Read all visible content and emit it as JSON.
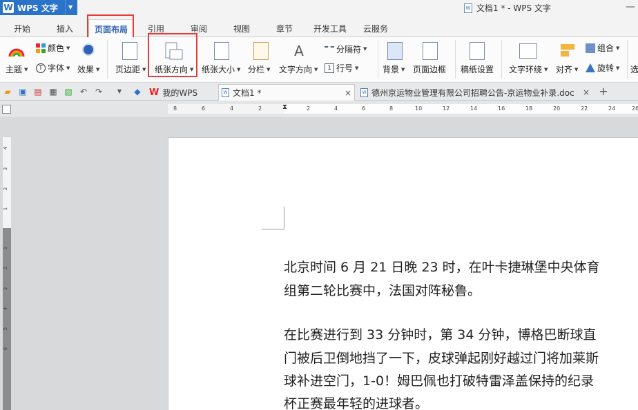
{
  "app": {
    "name": "WPS 文字"
  },
  "window": {
    "title": "文档1 * - WPS 文字",
    "minimize_glyph": "—"
  },
  "menu_tabs": [
    "开始",
    "插入",
    "页面布局",
    "引用",
    "审阅",
    "视图",
    "章节",
    "开发工具",
    "云服务"
  ],
  "active_menu_tab": "页面布局",
  "ribbon": {
    "theme": "主题",
    "color": "颜色",
    "font": "字体",
    "effect": "效果",
    "margins": "页边距",
    "orientation": "纸张方向",
    "size": "纸张大小",
    "columns": "分栏",
    "text_direction": "文字方向",
    "breaks": "分隔符",
    "line_numbers": "行号",
    "background": "背景",
    "page_border": "页面边框",
    "paper_settings": "稿纸设置",
    "text_wrap": "文字环绕",
    "align": "对齐",
    "group": "组合",
    "rotate": "旋转",
    "select": "选"
  },
  "doc_tabs": [
    {
      "label": "我的WPS"
    },
    {
      "label": "文档1 *"
    },
    {
      "label": "德州京运物业管理有限公司招聘公告-京运物业补录.doc"
    }
  ],
  "ruler": {
    "h_labels": [
      "8",
      "6",
      "4",
      "2",
      "2",
      "4",
      "6",
      "8",
      "10",
      "12",
      "14",
      "16",
      "18",
      "20",
      "22",
      "24",
      "26",
      "28"
    ],
    "v_labels": [
      "4",
      "3",
      "2",
      "1",
      "1",
      "2",
      "3",
      "4",
      "5",
      "6"
    ]
  },
  "document": {
    "para1_line1": "北京时间 6 月 21 日晚 23 时，在叶卡捷琳堡中央体育",
    "para1_line2": "组第二轮比赛中，法国对阵秘鲁。",
    "para2_line1": "在比赛进行到 33 分钟时，第 34 分钟，博格巴断球直",
    "para2_line2": "门被后卫倒地挡了一下，皮球弹起刚好越过门将加莱斯",
    "para2_line3": "球补进空门，1-0！姆巴佩也打破特雷泽盖保持的纪录",
    "para2_line4": "杯正赛最年轻的进球者。"
  },
  "colors": {
    "accent": "#2b72c9",
    "highlight": "#e53b3b"
  }
}
